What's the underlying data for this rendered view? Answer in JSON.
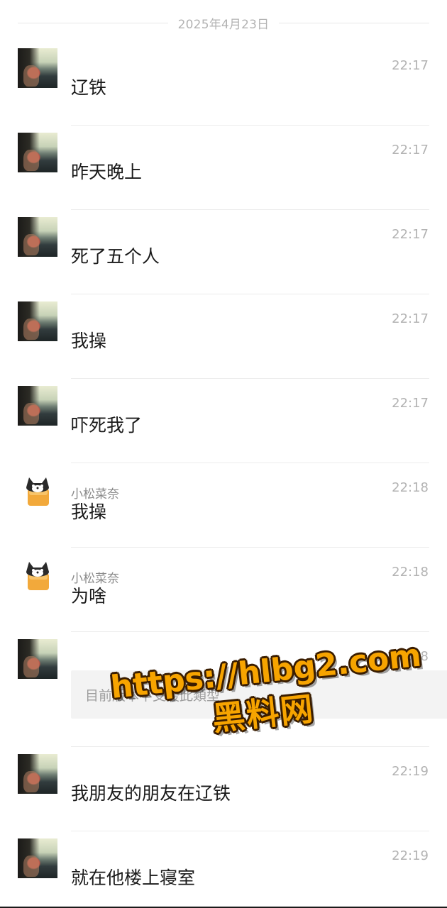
{
  "date_separator": "2025年4月23日",
  "messages": [
    {
      "avatar": "woman-photo-avatar",
      "sender": "",
      "time": "22:17",
      "text": "辽铁"
    },
    {
      "avatar": "woman-photo-avatar",
      "sender": "",
      "time": "22:17",
      "text": "昨天晚上"
    },
    {
      "avatar": "woman-photo-avatar",
      "sender": "",
      "time": "22:17",
      "text": "死了五个人"
    },
    {
      "avatar": "woman-photo-avatar",
      "sender": "",
      "time": "22:17",
      "text": "我操"
    },
    {
      "avatar": "woman-photo-avatar",
      "sender": "",
      "time": "22:17",
      "text": "吓死我了"
    },
    {
      "avatar": "cat-bread-avatar",
      "sender": "小松菜奈",
      "time": "22:18",
      "text": "我操"
    },
    {
      "avatar": "cat-bread-avatar",
      "sender": "小松菜奈",
      "time": "22:18",
      "text": "为啥"
    },
    {
      "avatar": "woman-photo-avatar",
      "sender": "",
      "time": "22:18",
      "unsupported": "目前版本不支援此類型"
    },
    {
      "avatar": "woman-photo-avatar",
      "sender": "",
      "time": "22:19",
      "text": "我朋友的朋友在辽铁"
    },
    {
      "avatar": "woman-photo-avatar",
      "sender": "",
      "time": "22:19",
      "text": "就在他楼上寝室"
    }
  ],
  "watermark": {
    "url": "https://hlbg2.com",
    "name": "黑料网",
    "color": "#f7a400"
  }
}
